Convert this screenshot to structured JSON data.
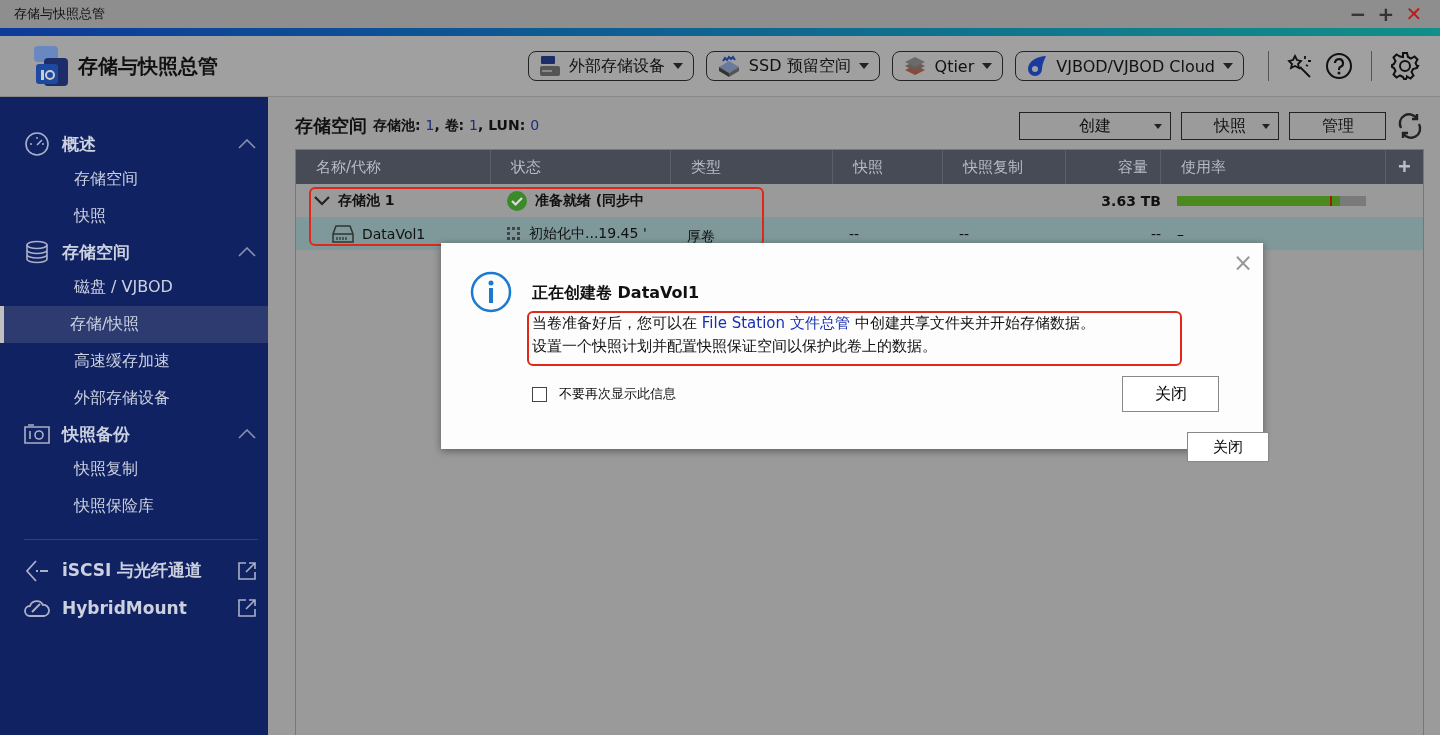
{
  "window": {
    "title": "存储与快照总管",
    "controls": [
      {
        "kind": "minimize",
        "text": "−"
      },
      {
        "kind": "maximize",
        "text": "+"
      },
      {
        "kind": "close",
        "text": "✕"
      }
    ]
  },
  "header": {
    "app_name": "存储与快照总管",
    "menus": [
      {
        "kind": "raid",
        "label": "外部存储设备"
      },
      {
        "kind": "ssd",
        "label": "SSD 预留空间"
      },
      {
        "kind": "qtier",
        "label": "Qtier"
      },
      {
        "kind": "vjbod",
        "label": "VJBOD/VJBOD Cloud"
      }
    ]
  },
  "sidebar": {
    "groups": [
      {
        "kind": "gauge",
        "label": "概述",
        "expanded": true,
        "children": [
          {
            "label": "存储空间",
            "selected": false
          },
          {
            "label": "快照",
            "selected": false
          }
        ]
      },
      {
        "kind": "database",
        "label": "存储空间",
        "expanded": true,
        "children": [
          {
            "label": "磁盘 / VJBOD",
            "selected": false
          },
          {
            "label": "存储/快照",
            "selected": true
          },
          {
            "label": "高速缓存加速",
            "selected": false
          },
          {
            "label": "外部存储设备",
            "selected": false
          }
        ]
      },
      {
        "kind": "camera",
        "label": "快照备份",
        "expanded": true,
        "children": [
          {
            "label": "快照复制",
            "selected": false
          },
          {
            "label": "快照保险库",
            "selected": false
          }
        ]
      }
    ],
    "links": [
      {
        "kind": "iscsi",
        "label": "iSCSI 与光纤通道"
      },
      {
        "kind": "cloud",
        "label": "HybridMount"
      }
    ]
  },
  "main": {
    "title": "存储空间",
    "stats": [
      {
        "label": "存储池: ",
        "value": "1"
      },
      {
        "label": ", 卷: ",
        "value": "1"
      },
      {
        "label": ", LUN: ",
        "value": "0"
      }
    ],
    "buttons": [
      {
        "label": "创建",
        "dropdown": true
      },
      {
        "label": "快照",
        "dropdown": true
      },
      {
        "label": "管理",
        "dropdown": false
      }
    ]
  },
  "table": {
    "add_button": "+",
    "columns": [
      "名称/代称",
      "状态",
      "类型",
      "快照",
      "快照复制",
      "容量",
      "使用率"
    ],
    "rows": [
      {
        "kind": "pool",
        "name": "存储池 1",
        "expanded": true,
        "selected": false,
        "status": "准备就绪 (同步中",
        "type": "",
        "snapshot": "",
        "replication": "",
        "capacity": "3.63 TB",
        "usage": {
          "level": 0.86
        }
      },
      {
        "kind": "volume",
        "name": "DataVol1",
        "selected": true,
        "status": "初始化中...19.45 '",
        "type": "厚卷",
        "snapshot": "--",
        "replication": "--",
        "capacity": "--",
        "usage_text": "–"
      }
    ]
  },
  "dialog": {
    "close": "×",
    "title": "正在创建卷 DataVol1",
    "message": [
      {
        "kind": "text",
        "text": "当卷准备好后，您可以在 "
      },
      {
        "kind": "link",
        "text": "File Station 文件总管"
      },
      {
        "kind": "text",
        "text": " 中创建共享文件夹并开始存储数据。"
      },
      {
        "kind": "break"
      },
      {
        "kind": "text",
        "text": "设置一个快照计划并配置快照保证空间以保护此卷上的数据。"
      }
    ],
    "checkbox": {
      "label": "不要再次显示此信息",
      "checked": false
    },
    "button": "关闭"
  },
  "floating_button": "关闭"
}
